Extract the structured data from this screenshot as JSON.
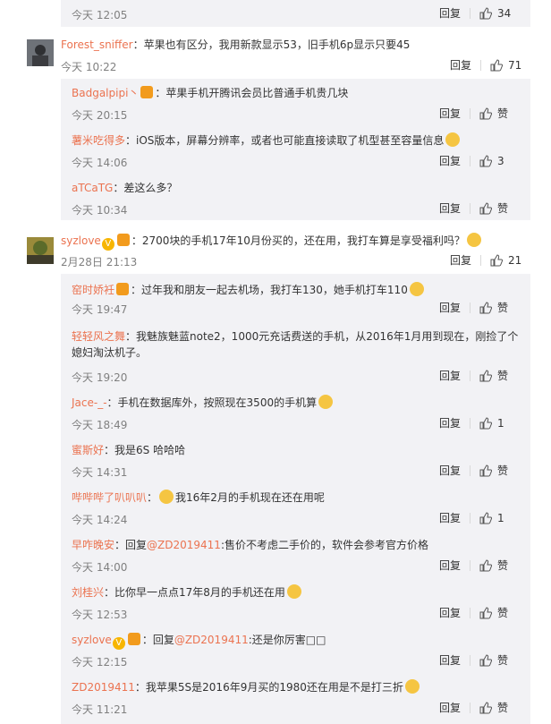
{
  "colors": {
    "username": "#eb7350",
    "subpanel": "#f2f2f5",
    "meta": "#808080",
    "link": "#eb7350"
  },
  "icons": {
    "like": "thumbs-up-icon",
    "emoji": "emoji-icon",
    "vip": "vip-badge-icon",
    "verify": "verified-v-icon"
  },
  "top": {
    "time": "今天 12:05",
    "reply": "回复",
    "likes": "34"
  },
  "comment1": {
    "user": "Forest_sniffer",
    "text": "：苹果也有区分，我用新款显示53，旧手机6p显示只要45",
    "time": "今天 10:22",
    "reply": "回复",
    "likes": "71",
    "replies": [
      {
        "user": "Badgalpipi丶",
        "text": "：苹果手机开腾讯会员比普通手机贵几块",
        "time": "今天 20:15",
        "reply": "回复",
        "likes": "赞"
      },
      {
        "user": "薯米吃得多",
        "text": "：iOS版本，屏幕分辨率，或者也可能直接读取了机型甚至容量信息",
        "time": "今天 14:06",
        "reply": "回复",
        "likes": "3"
      },
      {
        "user": "aTCaTG",
        "text": "：差这么多？",
        "time": "今天 10:34",
        "reply": "回复",
        "likes": "赞"
      }
    ]
  },
  "comment2": {
    "user": "syzlove",
    "text": "：2700块的手机17年10月份买的，还在用，我打车算是享受福利吗？",
    "time": "2月28日 21:13",
    "reply": "回复",
    "likes": "21",
    "replies": [
      {
        "user": "窑时娇衽",
        "text": "：过年我和朋友一起去机场，我打车130，她手机打车110",
        "time": "今天 19:47",
        "reply": "回复",
        "likes": "赞"
      },
      {
        "user": "轻轻风之舞",
        "text": "：我魅族魅蓝note2，1000元充话费送的手机，从2016年1月用到现在，刚捡了个",
        "text_cont": "媳妇淘汰机子。",
        "time": "今天 19:20",
        "reply": "回复",
        "likes": "赞"
      },
      {
        "user": "Jace-_-",
        "text": "：手机在数据库外，按照现在3500的手机算",
        "time": "今天 18:49",
        "reply": "回复",
        "likes": "1"
      },
      {
        "user": "蜜斯好",
        "text": "：我是6S 哈哈哈",
        "time": "今天 14:31",
        "reply": "回复",
        "likes": "赞"
      },
      {
        "user": "哔哔哔了叭叭叭",
        "text": "：",
        "text_after": "我16年2月的手机现在还在用呢",
        "time": "今天 14:24",
        "reply": "回复",
        "likes": "1"
      },
      {
        "user": "早咋晚安",
        "text": "：回复",
        "mention": "@ZD2019411",
        "text_after": ":售价不考虑二手价的，软件会参考官方价格",
        "time": "今天 14:00",
        "reply": "回复",
        "likes": "赞"
      },
      {
        "user": "刘桂兴",
        "text": "：比你早一点点17年8月的手机还在用",
        "time": "今天 12:53",
        "reply": "回复",
        "likes": "赞"
      },
      {
        "user": "syzlove",
        "text": "：回复",
        "mention": "@ZD2019411",
        "text_after": ":还是你厉害□□",
        "time": "今天 12:15",
        "reply": "回复",
        "likes": "赞"
      },
      {
        "user": "ZD2019411",
        "text": "：我苹果5S是2016年9月买的1980还在用是不是打三折",
        "time": "今天 11:21",
        "reply": "回复",
        "likes": "赞"
      }
    ]
  }
}
